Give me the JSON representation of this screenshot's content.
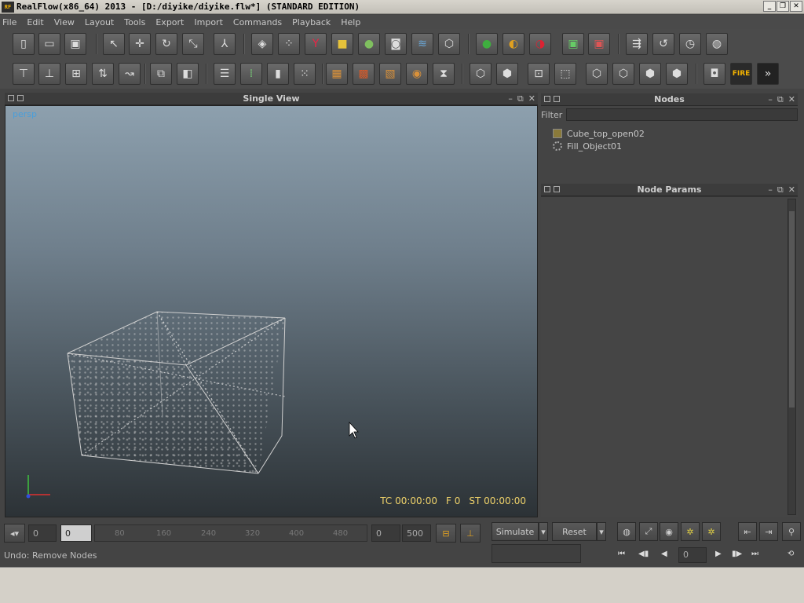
{
  "window": {
    "title": "RealFlow(x86_64) 2013 - [D:/diyike/diyike.flw*] (STANDARD EDITION)",
    "logo_text": "RF"
  },
  "menu": [
    "File",
    "Edit",
    "View",
    "Layout",
    "Tools",
    "Export",
    "Import",
    "Commands",
    "Playback",
    "Help"
  ],
  "viewport": {
    "panel_title": "Single View",
    "camera": "persp",
    "tc": "TC 00:00:00",
    "frame": "F 0",
    "st": "ST 00:00:00"
  },
  "nodes": {
    "panel_title": "Nodes",
    "filter_label": "Filter",
    "items": [
      "Cube_top_open02",
      "Fill_Object01"
    ]
  },
  "params": {
    "panel_title": "Node Params"
  },
  "timeline": {
    "start": "0",
    "current": "0",
    "ticks": [
      "80",
      "160",
      "240",
      "320",
      "400",
      "480"
    ],
    "range_start": "0",
    "range_end": "500",
    "simulate": "Simulate",
    "reset": "Reset",
    "frame_field": "0"
  },
  "status": {
    "text": "Undo: Remove Nodes"
  },
  "fire_label": "FIRE"
}
